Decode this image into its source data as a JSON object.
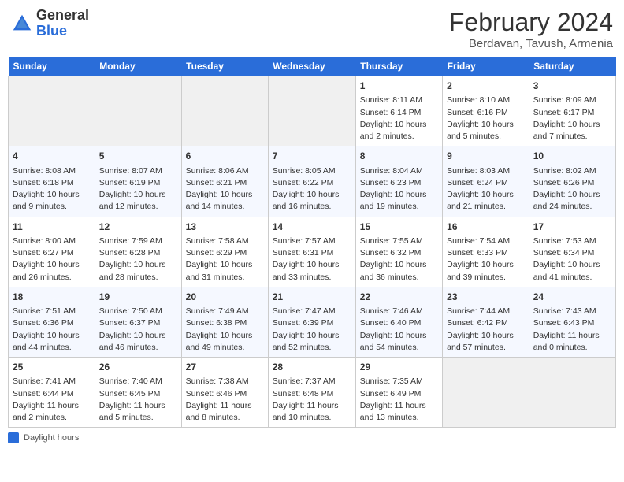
{
  "header": {
    "logo_general": "General",
    "logo_blue": "Blue",
    "month_title": "February 2024",
    "location": "Berdavan, Tavush, Armenia"
  },
  "days_of_week": [
    "Sunday",
    "Monday",
    "Tuesday",
    "Wednesday",
    "Thursday",
    "Friday",
    "Saturday"
  ],
  "weeks": [
    [
      {
        "day": "",
        "info": ""
      },
      {
        "day": "",
        "info": ""
      },
      {
        "day": "",
        "info": ""
      },
      {
        "day": "",
        "info": ""
      },
      {
        "day": "1",
        "info": "Sunrise: 8:11 AM\nSunset: 6:14 PM\nDaylight: 10 hours\nand 2 minutes."
      },
      {
        "day": "2",
        "info": "Sunrise: 8:10 AM\nSunset: 6:16 PM\nDaylight: 10 hours\nand 5 minutes."
      },
      {
        "day": "3",
        "info": "Sunrise: 8:09 AM\nSunset: 6:17 PM\nDaylight: 10 hours\nand 7 minutes."
      }
    ],
    [
      {
        "day": "4",
        "info": "Sunrise: 8:08 AM\nSunset: 6:18 PM\nDaylight: 10 hours\nand 9 minutes."
      },
      {
        "day": "5",
        "info": "Sunrise: 8:07 AM\nSunset: 6:19 PM\nDaylight: 10 hours\nand 12 minutes."
      },
      {
        "day": "6",
        "info": "Sunrise: 8:06 AM\nSunset: 6:21 PM\nDaylight: 10 hours\nand 14 minutes."
      },
      {
        "day": "7",
        "info": "Sunrise: 8:05 AM\nSunset: 6:22 PM\nDaylight: 10 hours\nand 16 minutes."
      },
      {
        "day": "8",
        "info": "Sunrise: 8:04 AM\nSunset: 6:23 PM\nDaylight: 10 hours\nand 19 minutes."
      },
      {
        "day": "9",
        "info": "Sunrise: 8:03 AM\nSunset: 6:24 PM\nDaylight: 10 hours\nand 21 minutes."
      },
      {
        "day": "10",
        "info": "Sunrise: 8:02 AM\nSunset: 6:26 PM\nDaylight: 10 hours\nand 24 minutes."
      }
    ],
    [
      {
        "day": "11",
        "info": "Sunrise: 8:00 AM\nSunset: 6:27 PM\nDaylight: 10 hours\nand 26 minutes."
      },
      {
        "day": "12",
        "info": "Sunrise: 7:59 AM\nSunset: 6:28 PM\nDaylight: 10 hours\nand 28 minutes."
      },
      {
        "day": "13",
        "info": "Sunrise: 7:58 AM\nSunset: 6:29 PM\nDaylight: 10 hours\nand 31 minutes."
      },
      {
        "day": "14",
        "info": "Sunrise: 7:57 AM\nSunset: 6:31 PM\nDaylight: 10 hours\nand 33 minutes."
      },
      {
        "day": "15",
        "info": "Sunrise: 7:55 AM\nSunset: 6:32 PM\nDaylight: 10 hours\nand 36 minutes."
      },
      {
        "day": "16",
        "info": "Sunrise: 7:54 AM\nSunset: 6:33 PM\nDaylight: 10 hours\nand 39 minutes."
      },
      {
        "day": "17",
        "info": "Sunrise: 7:53 AM\nSunset: 6:34 PM\nDaylight: 10 hours\nand 41 minutes."
      }
    ],
    [
      {
        "day": "18",
        "info": "Sunrise: 7:51 AM\nSunset: 6:36 PM\nDaylight: 10 hours\nand 44 minutes."
      },
      {
        "day": "19",
        "info": "Sunrise: 7:50 AM\nSunset: 6:37 PM\nDaylight: 10 hours\nand 46 minutes."
      },
      {
        "day": "20",
        "info": "Sunrise: 7:49 AM\nSunset: 6:38 PM\nDaylight: 10 hours\nand 49 minutes."
      },
      {
        "day": "21",
        "info": "Sunrise: 7:47 AM\nSunset: 6:39 PM\nDaylight: 10 hours\nand 52 minutes."
      },
      {
        "day": "22",
        "info": "Sunrise: 7:46 AM\nSunset: 6:40 PM\nDaylight: 10 hours\nand 54 minutes."
      },
      {
        "day": "23",
        "info": "Sunrise: 7:44 AM\nSunset: 6:42 PM\nDaylight: 10 hours\nand 57 minutes."
      },
      {
        "day": "24",
        "info": "Sunrise: 7:43 AM\nSunset: 6:43 PM\nDaylight: 11 hours\nand 0 minutes."
      }
    ],
    [
      {
        "day": "25",
        "info": "Sunrise: 7:41 AM\nSunset: 6:44 PM\nDaylight: 11 hours\nand 2 minutes."
      },
      {
        "day": "26",
        "info": "Sunrise: 7:40 AM\nSunset: 6:45 PM\nDaylight: 11 hours\nand 5 minutes."
      },
      {
        "day": "27",
        "info": "Sunrise: 7:38 AM\nSunset: 6:46 PM\nDaylight: 11 hours\nand 8 minutes."
      },
      {
        "day": "28",
        "info": "Sunrise: 7:37 AM\nSunset: 6:48 PM\nDaylight: 11 hours\nand 10 minutes."
      },
      {
        "day": "29",
        "info": "Sunrise: 7:35 AM\nSunset: 6:49 PM\nDaylight: 11 hours\nand 13 minutes."
      },
      {
        "day": "",
        "info": ""
      },
      {
        "day": "",
        "info": ""
      }
    ]
  ],
  "legend": {
    "label": "Daylight hours"
  }
}
